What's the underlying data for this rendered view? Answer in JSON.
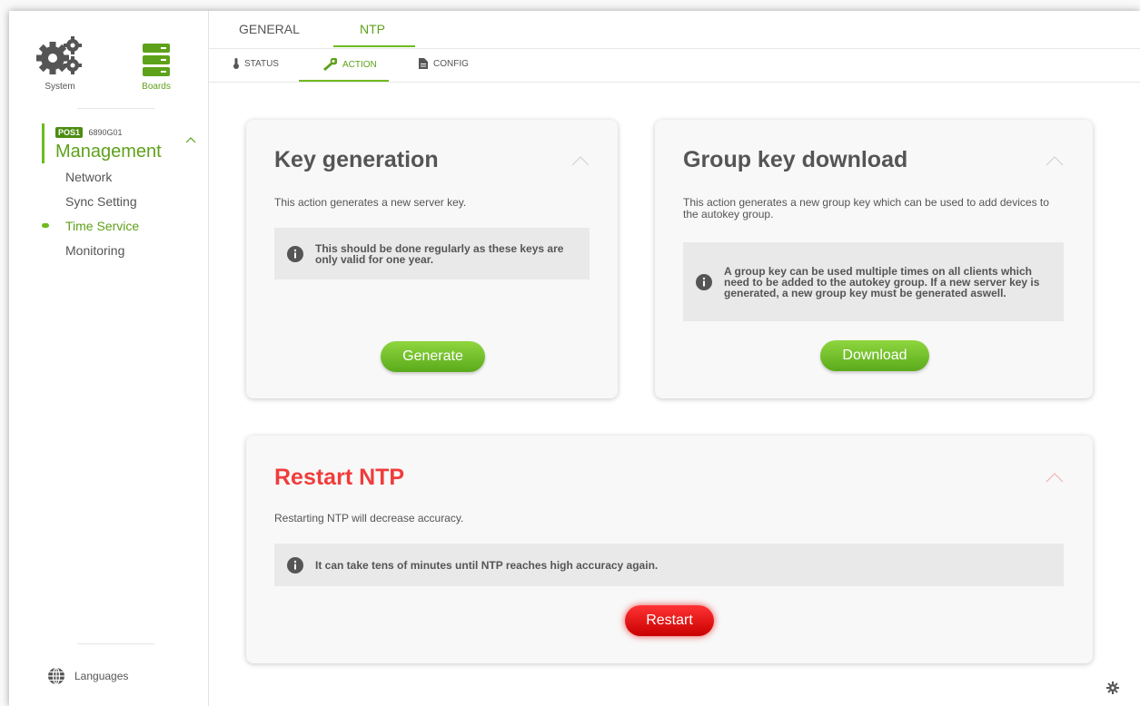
{
  "sidebar": {
    "top_icons": [
      {
        "label": "System",
        "icon": "gears-icon"
      },
      {
        "label": "Boards",
        "icon": "server-stack-icon"
      }
    ],
    "position": {
      "badge": "POS1",
      "code": "6890G01"
    },
    "section_title": "Management",
    "nav_items": [
      {
        "label": "Network"
      },
      {
        "label": "Sync Setting"
      },
      {
        "label": "Time Service"
      },
      {
        "label": "Monitoring"
      }
    ],
    "active_nav": "Time Service",
    "languages_label": "Languages"
  },
  "tabs": [
    {
      "label": "GENERAL"
    },
    {
      "label": "NTP"
    }
  ],
  "active_tab": "NTP",
  "subtabs": [
    {
      "label": "STATUS",
      "icon": "thermometer-icon"
    },
    {
      "label": "ACTION",
      "icon": "wrench-icon"
    },
    {
      "label": "CONFIG",
      "icon": "document-icon"
    }
  ],
  "active_subtab": "ACTION",
  "cards": {
    "key_generation": {
      "title": "Key generation",
      "description": "This action generates a new server key.",
      "info": "This should be done regularly as these keys are only valid for one year.",
      "button": "Generate"
    },
    "group_key": {
      "title": "Group key download",
      "description": "This action generates a new group key which can be used to add devices to the autokey group.",
      "info": "A group key can be used multiple times on all clients which need to be added to the autokey group. If a new server key is generated, a new group key must be generated aswell.",
      "button": "Download"
    },
    "restart": {
      "title": "Restart NTP",
      "description": "Restarting NTP will decrease accuracy.",
      "info": "It can take tens of minutes until NTP reaches high accuracy again.",
      "button": "Restart"
    }
  },
  "colors": {
    "accent_green": "#5ea11a",
    "danger_red": "#f03c3c",
    "info_bg": "#e9e9e9"
  }
}
